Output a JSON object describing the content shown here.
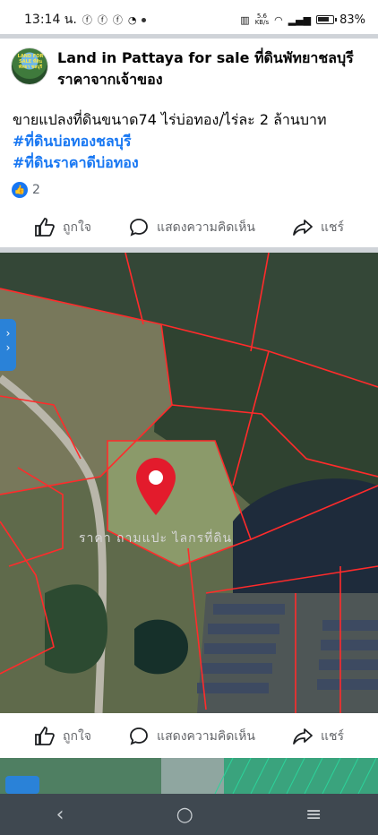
{
  "status_bar": {
    "time": "13:14 น.",
    "kbs_top": "5.6",
    "kbs_bottom": "KB/s",
    "battery": "83%",
    "battery_level": 0.83
  },
  "post": {
    "page_name_line1": "Land in Pattaya for sale ที่ดินพัทยาชลบุรี",
    "page_name_line2": "ราคาจากเจ้าของ",
    "avatar_text": "LAND FOR SALE ที่ดินพัทยา ชลบุรี",
    "text_line": "ขายแปลงที่ดินขนาด74 ไร่บ่อทอง/ไร่ละ 2 ล้านบาท",
    "hashtags": [
      "#ที่ดินบ่อทองชลบุรี",
      "#ที่ดินราคาดีบ่อทอง"
    ],
    "reaction_count": "2",
    "map_label": "ราคา ถามแปะ ไลกรที่ดิน"
  },
  "actions": {
    "like": "ถูกใจ",
    "comment": "แสดงความคิดเห็น",
    "share": "แชร์"
  },
  "nav": {
    "back": "‹",
    "home": "○",
    "menu": "≡"
  }
}
